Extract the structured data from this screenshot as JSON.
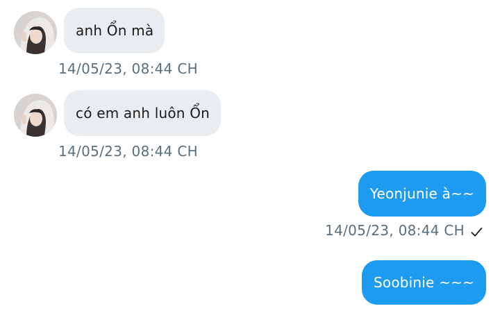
{
  "messages": [
    {
      "direction": "incoming",
      "text": "anh Ổn mà",
      "timestamp": "14/05/23,  08:44 CH"
    },
    {
      "direction": "incoming",
      "text": "có em anh luôn Ổn",
      "timestamp": "14/05/23,  08:44 CH"
    },
    {
      "direction": "outgoing",
      "text": "Yeonjunie à~~",
      "timestamp": "14/05/23,  08:44 CH",
      "status_icon": "check-icon"
    },
    {
      "direction": "outgoing",
      "text": "Soobinie ~~~"
    }
  ],
  "colors": {
    "incoming_bubble": "#e9edf0",
    "outgoing_bubble": "#1d9bf0",
    "timestamp_text": "#5a6f7e"
  }
}
